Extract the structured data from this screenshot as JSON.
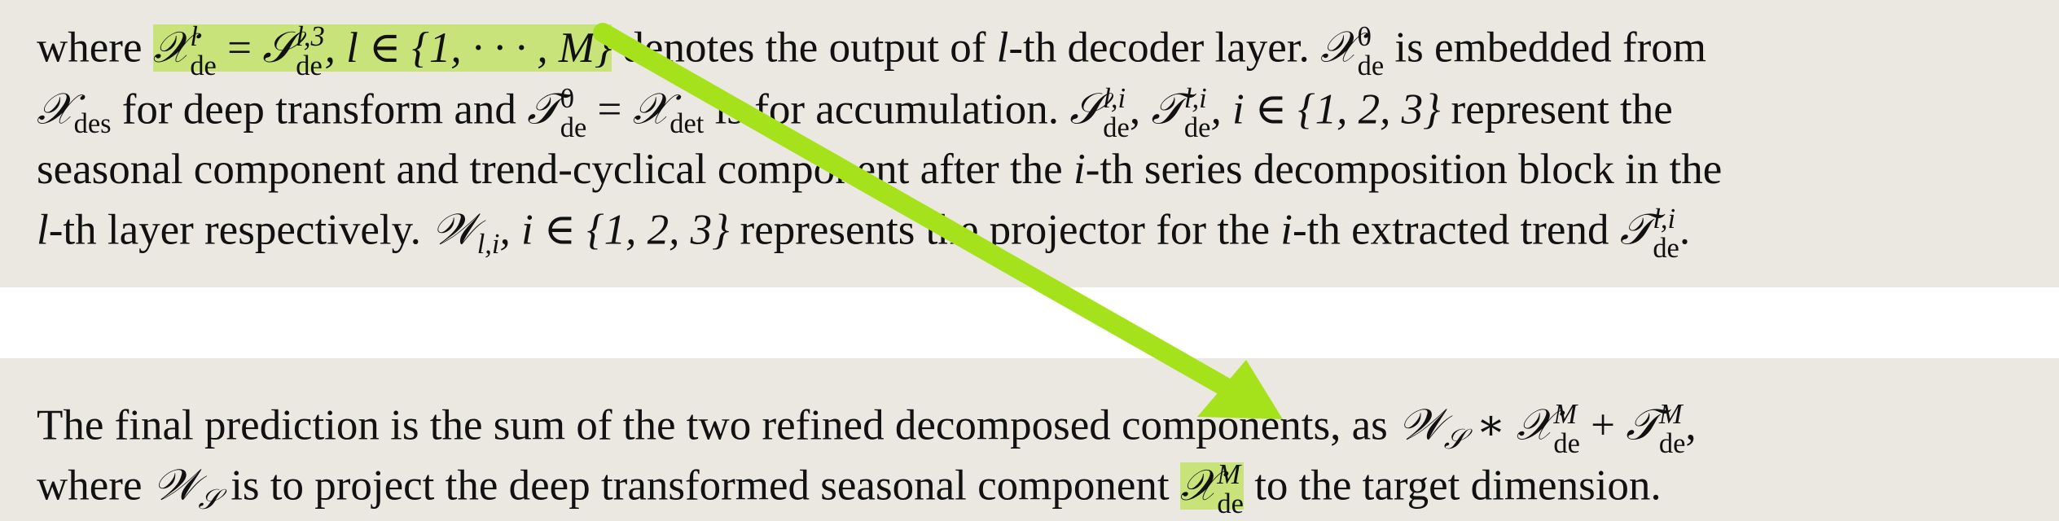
{
  "paragraph1": {
    "l1_where": "where ",
    "l1_hl_X": "𝒳",
    "l1_hl_sub_de": "de",
    "l1_hl_sup_l": "l",
    "l1_hl_eq": " = ",
    "l1_hl_S": "𝒮",
    "l1_hl_S_sup": "l,3",
    "l1_hl_S_sub": "de",
    "l1_hl_rest": ", l ∈ {1, · · · , M}",
    "l1_after": " denotes the output of ",
    "l1_l": "l",
    "l1_after2": "-th decoder layer. ",
    "l1_X0": "𝒳",
    "l1_X0_sup": "0",
    "l1_X0_sub": "de",
    "l1_end": " is embedded from",
    "l2_X": "𝒳",
    "l2_X_sub": "des",
    "l2_text1": " for deep transform and ",
    "l2_T": "𝒯",
    "l2_T_sup": "0",
    "l2_T_sub": "de",
    "l2_eq": " = ",
    "l2_X2": "𝒳",
    "l2_X2_sub": "det",
    "l2_text2": " is for accumulation. ",
    "l2_S": "𝒮",
    "l2_S_sup": "l,i",
    "l2_S_sub": "de",
    "l2_comma": ", ",
    "l2_T2": "𝒯",
    "l2_T2_sup": "l,i",
    "l2_T2_sub": "de",
    "l2_set": ", i ∈ {1, 2, 3}",
    "l2_end": " represent the",
    "l3_text": "seasonal component and trend-cyclical component after the ",
    "l3_i": "i",
    "l3_end": "-th series decomposition block in the",
    "l4_l": "l",
    "l4_text1": "-th layer respectively. ",
    "l4_W": "𝒲",
    "l4_W_sub": "l,i",
    "l4_set": ", i ∈ {1, 2, 3}",
    "l4_text2": " represents the projector for the ",
    "l4_i": "i",
    "l4_text3": "-th extracted trend ",
    "l4_T": "𝒯",
    "l4_T_sup": "l,i",
    "l4_T_sub": "de",
    "l4_end": "."
  },
  "paragraph2": {
    "l1_text": "The final prediction is the sum of the two refined decomposed components, as ",
    "l1_W": "𝒲",
    "l1_W_sub": "𝒮",
    "l1_star": " ∗ ",
    "l1_X": "𝒳",
    "l1_X_sup": "M",
    "l1_X_sub": "de",
    "l1_plus": " + ",
    "l1_T": "𝒯",
    "l1_T_sup": "M",
    "l1_T_sub": "de",
    "l1_end": ",",
    "l2_where": "where ",
    "l2_W": "𝒲",
    "l2_W_sub": "𝒮",
    "l2_text1": " is to project the deep transformed seasonal component ",
    "l2_X": "𝒳",
    "l2_X_sup": "M",
    "l2_X_sub": "de",
    "l2_end": " to the target dimension."
  },
  "annotation": {
    "arrow_color": "#a6e21c",
    "highlight_color": "#c7e37a"
  }
}
